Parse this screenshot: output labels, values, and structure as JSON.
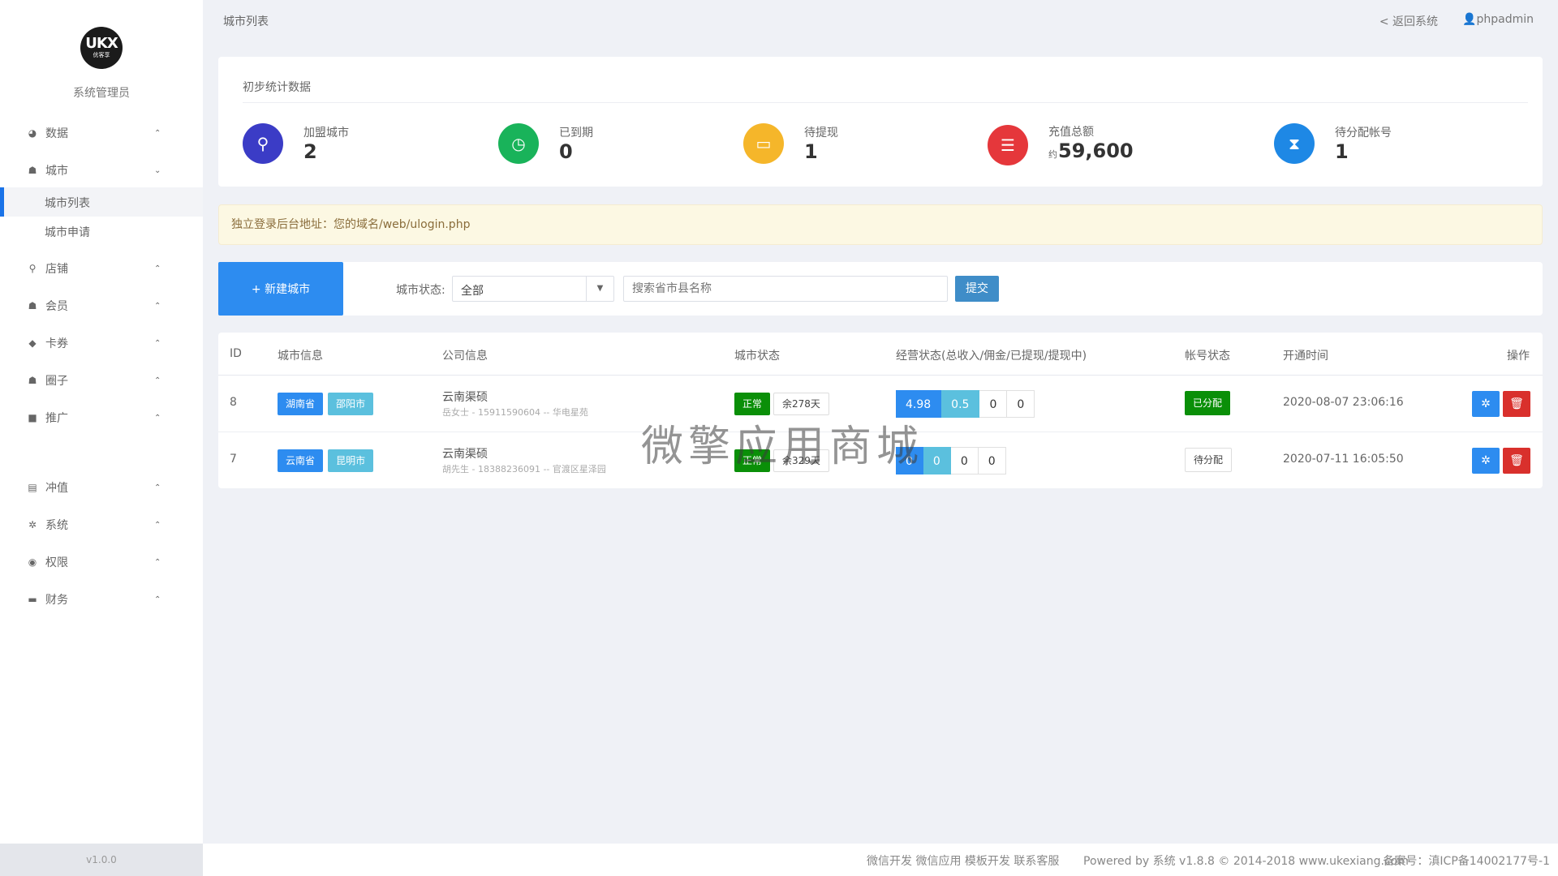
{
  "sidebar": {
    "logo_text": "UKX",
    "logo_sub": "优客享",
    "role": "系统管理员",
    "items": [
      {
        "label": "数据",
        "icon": "pie-chart-icon",
        "glyph": "◕",
        "chev": "⌃"
      },
      {
        "label": "城市",
        "icon": "users-icon",
        "glyph": "☗",
        "chev": "⌄"
      },
      {
        "label": "店铺",
        "icon": "map-pin-icon",
        "glyph": "⚲",
        "chev": "⌃"
      },
      {
        "label": "会员",
        "icon": "user-icon",
        "glyph": "☗",
        "chev": "⌃"
      },
      {
        "label": "卡券",
        "icon": "tag-icon",
        "glyph": "◆",
        "chev": "⌃"
      },
      {
        "label": "圈子",
        "icon": "group-icon",
        "glyph": "☗",
        "chev": "⌃"
      },
      {
        "label": "推广",
        "icon": "video-icon",
        "glyph": "■",
        "chev": "⌃"
      },
      {
        "label": "冲值",
        "icon": "book-icon",
        "glyph": "▤",
        "chev": "⌃"
      },
      {
        "label": "系统",
        "icon": "gear-icon",
        "glyph": "✲",
        "chev": "⌃"
      },
      {
        "label": "权限",
        "icon": "lock-circle-icon",
        "glyph": "◉",
        "chev": "⌃"
      },
      {
        "label": "财务",
        "icon": "card-icon",
        "glyph": "▬",
        "chev": "⌃"
      }
    ],
    "sub_items": [
      "城市列表",
      "城市申请"
    ],
    "version": "v1.0.0"
  },
  "topbar": {
    "breadcrumb": "城市列表",
    "back": "< 返回系统",
    "user": "phpadmin"
  },
  "stats": {
    "title": "初步统计数据",
    "items": [
      {
        "label": "加盟城市",
        "value": "2",
        "prefix": "",
        "color": "#3b3cc6",
        "icon": "map-marker-icon",
        "glyph": "⚲"
      },
      {
        "label": "已到期",
        "value": "0",
        "prefix": "",
        "color": "#19b35a",
        "icon": "clock-icon",
        "glyph": "◷"
      },
      {
        "label": "待提现",
        "value": "1",
        "prefix": "",
        "color": "#f5b62a",
        "icon": "credit-card-icon",
        "glyph": "▭"
      },
      {
        "label": "充值总额",
        "value": "59,600",
        "prefix": "约",
        "color": "#e5373b",
        "icon": "database-icon",
        "glyph": "☰"
      },
      {
        "label": "待分配帐号",
        "value": "1",
        "prefix": "",
        "color": "#1e88e5",
        "icon": "hourglass-icon",
        "glyph": "⧗"
      }
    ]
  },
  "notice": "独立登录后台地址：您的域名/web/ulogin.php",
  "filter": {
    "new_button": "+ 新建城市",
    "status_label": "城市状态:",
    "status_value": "全部",
    "search_placeholder": "搜索省市县名称",
    "submit": "提交"
  },
  "table": {
    "headers": [
      "ID",
      "城市信息",
      "公司信息",
      "城市状态",
      "经营状态(总收入/佣金/已提现/提现中)",
      "帐号状态",
      "开通时间",
      "操作"
    ],
    "rows": [
      {
        "id": "8",
        "province": "湖南省",
        "city": "邵阳市",
        "company": "云南渠硕",
        "contact": "岳女士 - 15911590604 -- 华电星苑",
        "status": "正常",
        "days": "余278天",
        "biz": [
          "4.98",
          "0.5",
          "0",
          "0"
        ],
        "account": "已分配",
        "account_on": true,
        "time": "2020-08-07 23:06:16"
      },
      {
        "id": "7",
        "province": "云南省",
        "city": "昆明市",
        "company": "云南渠硕",
        "contact": "胡先生 - 18388236091 -- 官渡区星泽园",
        "status": "正常",
        "days": "余329天",
        "biz": [
          "0",
          "0",
          "0",
          "0"
        ],
        "account": "待分配",
        "account_on": false,
        "time": "2020-07-11 16:05:50"
      }
    ]
  },
  "watermark": "微擎应用商城",
  "footer": {
    "links": "微信开发 微信应用 模板开发 联系客服",
    "powered": "Powered by 系统 v1.8.8 © 2014-2018 www.ukexiang.com",
    "icp": "备案号：滇ICP备14002177号-1"
  }
}
